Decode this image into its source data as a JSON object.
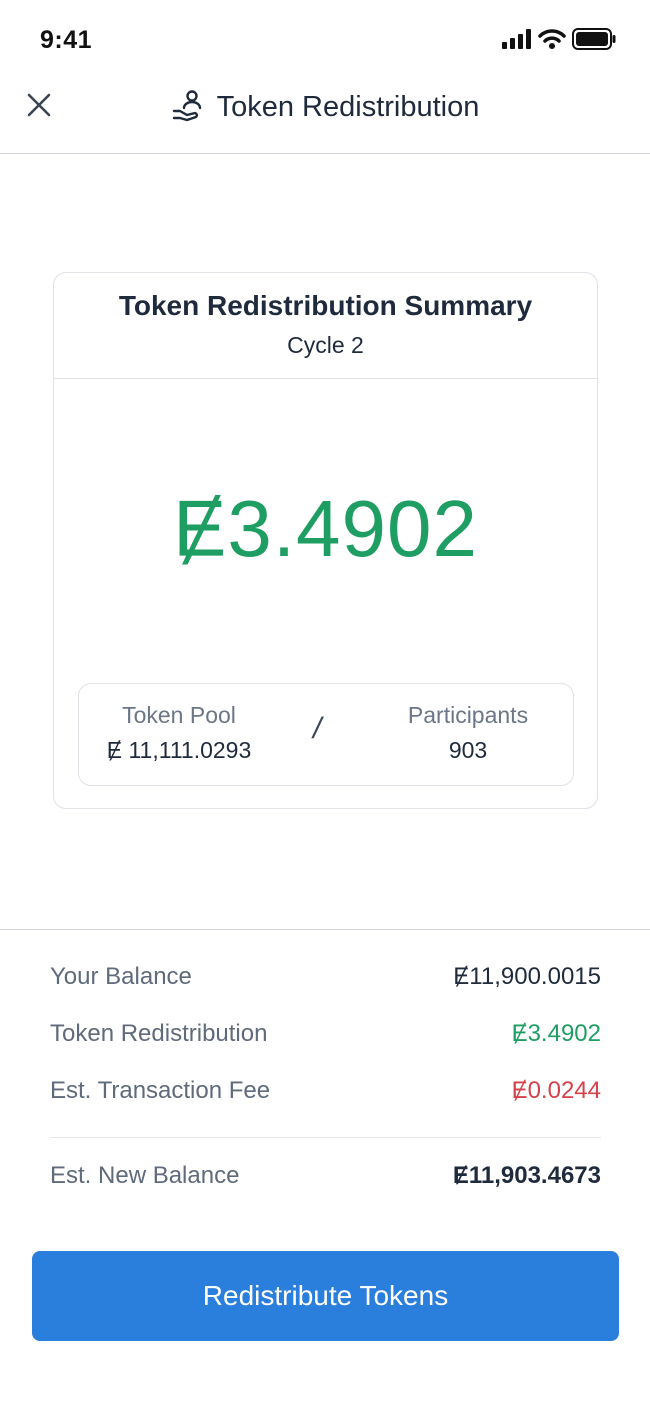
{
  "status_bar": {
    "time": "9:41",
    "icons": [
      "cellular-signal-icon",
      "wifi-icon",
      "battery-icon"
    ]
  },
  "header": {
    "title": "Token Redistribution",
    "close_icon": "close-icon",
    "title_icon": "hand-with-person-icon"
  },
  "summary": {
    "title": "Token Redistribution Summary",
    "subtitle": "Cycle 2",
    "amount": "Ɇ3.4902",
    "token_pool_label": "Token Pool",
    "token_pool_value": "Ɇ 11,111.0293",
    "separator": "/",
    "participants_label": "Participants",
    "participants_value": "903"
  },
  "breakdown": {
    "rows": [
      {
        "label": "Your Balance",
        "value": "Ɇ11,900.0015"
      },
      {
        "label": "Token Redistribution",
        "value": "Ɇ3.4902"
      },
      {
        "label": "Est. Transaction Fee",
        "value": "Ɇ0.0244"
      }
    ],
    "total": {
      "label": "Est. New Balance",
      "value": "Ɇ11,903.4673"
    }
  },
  "cta": {
    "label": "Redistribute Tokens"
  },
  "colors": {
    "accent": "#2a7fdc",
    "positive": "#1e9e62",
    "negative": "#d6424b",
    "text": "#1f2a3c",
    "muted": "#5f6a7b"
  }
}
